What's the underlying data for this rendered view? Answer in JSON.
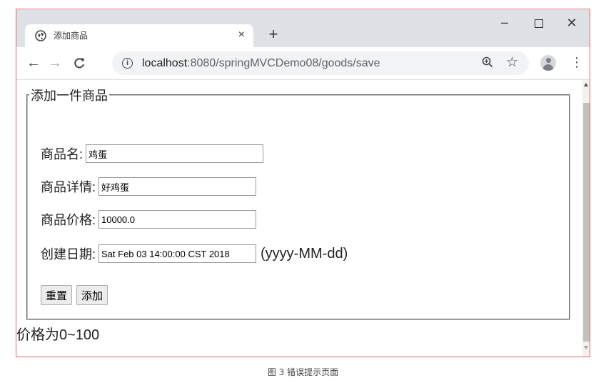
{
  "browser": {
    "tab_title": "添加商品",
    "tab_close": "×",
    "new_tab": "+",
    "win_min": "–",
    "win_close": "✕",
    "url_host": "localhost",
    "url_path": ":8080/springMVCDemo08/goods/save",
    "icons": [
      "chrome-globe-icon",
      "back-arrow-icon",
      "forward-arrow-icon",
      "reload-icon",
      "info-icon",
      "zoom-icon",
      "star-icon",
      "avatar-icon",
      "menu-icon"
    ]
  },
  "form": {
    "legend": "添加一件商品",
    "name_label": "商品名:",
    "name_value": "鸡蛋",
    "detail_label": "商品详情:",
    "detail_value": "好鸡蛋",
    "price_label": "商品价格:",
    "price_value": "10000.0",
    "date_label": "创建日期:",
    "date_value": "Sat Feb 03 14:00:00 CST 2018",
    "date_hint": "(yyyy-MM-dd)",
    "reset_label": "重置",
    "submit_label": "添加"
  },
  "error_message": "价格为0~100",
  "caption": "图 3  错误提示页面"
}
